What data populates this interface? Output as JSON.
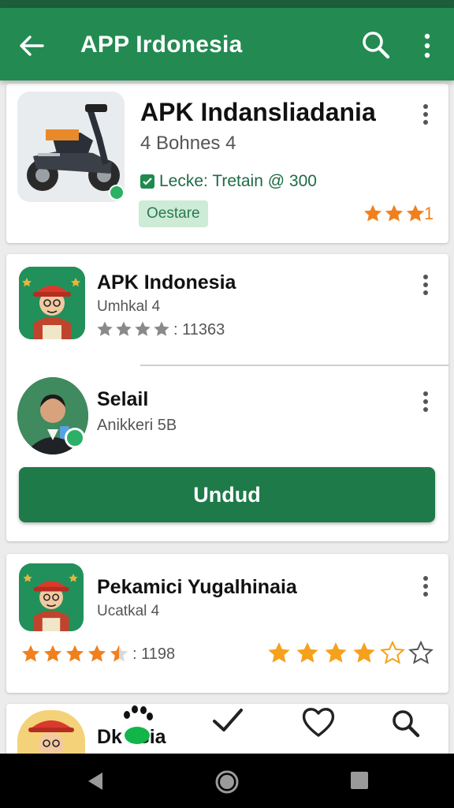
{
  "appbar": {
    "title": "APP Irdonesia"
  },
  "featured": {
    "title": "APK Indansliadania",
    "subtitle": "4 Bohnes 4",
    "check_label": "Lecke: Tretain @ 300",
    "tag": "Oestare",
    "rating_suffix": "1",
    "stars": 3
  },
  "list": [
    {
      "title": "APK Indonesia",
      "subtitle": "Umhkal 4",
      "rating_text": ": 11363",
      "stars": 4
    },
    {
      "title": "Selail",
      "subtitle": "Anikkeri 5B"
    }
  ],
  "download_button": "Undud",
  "third": {
    "title": "Pekamici Yugalhinaia",
    "subtitle": "Ucatkal 4",
    "rating_text": ": 1198",
    "stars_left": 4.5,
    "stars_right": 4.5
  },
  "partial": {
    "title": "Dk  esia"
  },
  "bottom_nav": [
    "paw-icon",
    "check-icon",
    "heart-icon",
    "search-icon"
  ],
  "system_nav": [
    "back",
    "home",
    "recents"
  ],
  "colors": {
    "primary": "#238a52",
    "button": "#1f7a4a",
    "star": "#f0801e",
    "star_gray": "#8a8a8a"
  }
}
